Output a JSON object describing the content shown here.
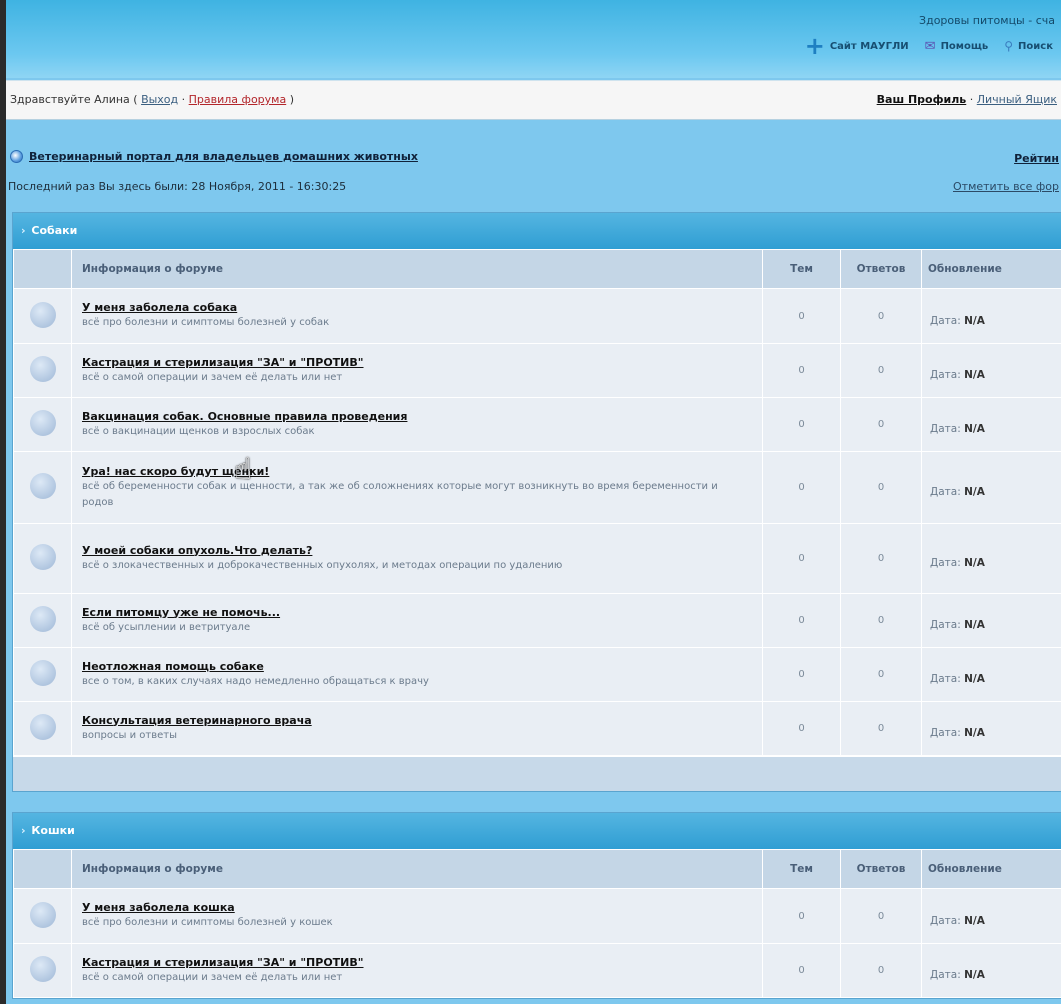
{
  "header": {
    "slogan": "Здоровы питомцы - сча",
    "links": [
      {
        "label": "Сайт МАУГЛИ",
        "icon": "plus-icon"
      },
      {
        "label": "Помощь",
        "icon": "help-icon"
      },
      {
        "label": "Поиск",
        "icon": "search-icon"
      }
    ]
  },
  "userbar": {
    "greeting": "Здравствуйте Алина (",
    "logout": "Выход",
    "sep": " · ",
    "rules": "Правила форума",
    "close": " )",
    "profile": "Ваш Профиль",
    "profile_sep": " · ",
    "mailbox": "Личный Ящик"
  },
  "nav": {
    "portal": "Ветеринарный портал для владельцев домашних животных",
    "last_visit": "Последний раз Вы здесь были: 28 Ноября, 2011 - 16:30:25",
    "rating": "Рейтин",
    "mark_all": "Отметить все фор"
  },
  "columns": {
    "info": "Информация о форуме",
    "topics": "Тем",
    "replies": "Ответов",
    "updated": "Обновление"
  },
  "categories": [
    {
      "title": "Собаки",
      "forums": [
        {
          "title": "У меня заболела собака",
          "desc": "всё про болезни и симптомы болезней у собак",
          "topics": "0",
          "replies": "0",
          "date_label": "Дата:",
          "date_value": "N/A"
        },
        {
          "title": "Кастрация и стерилизация \"ЗА\" и \"ПРОТИВ\"",
          "desc": "всё о самой операции и зачем её делать или нет",
          "topics": "0",
          "replies": "0",
          "date_label": "Дата:",
          "date_value": "N/A"
        },
        {
          "title": "Вакцинация собак. Основные правила проведения",
          "desc": "всё о вакцинации щенков и взрослых собак",
          "topics": "0",
          "replies": "0",
          "date_label": "Дата:",
          "date_value": "N/A"
        },
        {
          "title": "Ура! нас скоро будут щенки!",
          "desc": "всё об беременности собак и щенности, а так же об соложнениях которые могут возникнуть во время беременности и родов",
          "topics": "0",
          "replies": "0",
          "date_label": "Дата:",
          "date_value": "N/A"
        },
        {
          "title": "У моей собаки опухоль.Что делать?",
          "desc": "всё о злокачественных и доброкачественных опухолях, и методах операции по удалению",
          "topics": "0",
          "replies": "0",
          "date_label": "Дата:",
          "date_value": "N/A"
        },
        {
          "title": "Если питомцу уже не помочь...",
          "desc": "всё об усыплении и ветритуале",
          "topics": "0",
          "replies": "0",
          "date_label": "Дата:",
          "date_value": "N/A"
        },
        {
          "title": "Неотложная помощь собаке",
          "desc": "все о том, в каких случаях надо немедленно обращаться к врачу",
          "topics": "0",
          "replies": "0",
          "date_label": "Дата:",
          "date_value": "N/A"
        },
        {
          "title": "Консультация ветеринарного врача",
          "desc": "вопросы и ответы",
          "topics": "0",
          "replies": "0",
          "date_label": "Дата:",
          "date_value": "N/A"
        }
      ]
    },
    {
      "title": "Кошки",
      "forums": [
        {
          "title": "У меня заболела кошка",
          "desc": "всё про болезни и симптомы болезней у кошек",
          "topics": "0",
          "replies": "0",
          "date_label": "Дата:",
          "date_value": "N/A"
        },
        {
          "title": "Кастрация и стерилизация \"ЗА\" и \"ПРОТИВ\"",
          "desc": "всё о самой операции и зачем её делать или нет",
          "topics": "0",
          "replies": "0",
          "date_label": "Дата:",
          "date_value": "N/A"
        }
      ]
    }
  ]
}
